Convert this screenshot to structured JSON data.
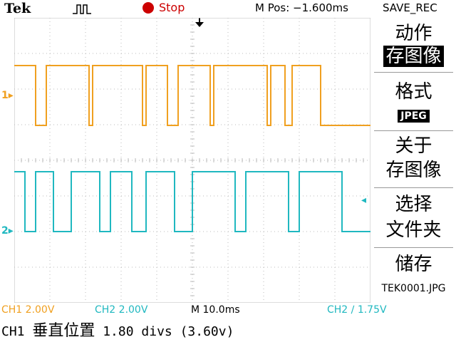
{
  "top_bar": {
    "brand": "Tek",
    "run_state": "Stop",
    "position": "M Pos: −1.600ms",
    "menu_title": "SAVE_REC"
  },
  "colors": {
    "ch1": "#f0a020",
    "ch2": "#20b8c0",
    "stop": "#cc0000"
  },
  "markers": {
    "ch1": "1▸",
    "ch2": "2▸",
    "trigger_level": "◂"
  },
  "menu": {
    "action_label": "动作",
    "action_value": "存图像",
    "format_label": "格式",
    "format_value": "JPEG",
    "about_line1": "关于",
    "about_line2": "存图像",
    "select_line1": "选择",
    "select_line2": "文件夹",
    "save_label": "储存",
    "save_filename": "TEK0001.JPG"
  },
  "readouts": {
    "ch1": "CH1  2.00V",
    "ch2": "CH2  2.00V",
    "timebase": "M 10.0ms",
    "trigger": "CH2 ∕ 1.75V"
  },
  "status": {
    "prefix": "CH1 ",
    "label": "垂直位置",
    "value": " 1.80 divs (3.60v)"
  },
  "waveforms": {
    "ch1_levels": [
      1,
      0,
      1,
      0,
      1,
      0,
      1,
      0,
      1,
      0,
      1,
      0,
      1,
      0,
      1,
      0
    ],
    "ch1_edges": [
      0.0,
      0.06,
      0.09,
      0.21,
      0.22,
      0.36,
      0.37,
      0.43,
      0.46,
      0.55,
      0.56,
      0.71,
      0.72,
      0.76,
      0.78,
      0.86
    ],
    "ch2_levels": [
      1,
      0,
      1,
      0,
      1,
      0,
      1,
      0,
      1,
      0,
      1,
      0,
      1,
      0,
      1,
      0
    ],
    "ch2_edges": [
      0.0,
      0.03,
      0.06,
      0.11,
      0.16,
      0.24,
      0.27,
      0.33,
      0.37,
      0.45,
      0.5,
      0.62,
      0.65,
      0.77,
      0.8,
      0.92
    ]
  }
}
